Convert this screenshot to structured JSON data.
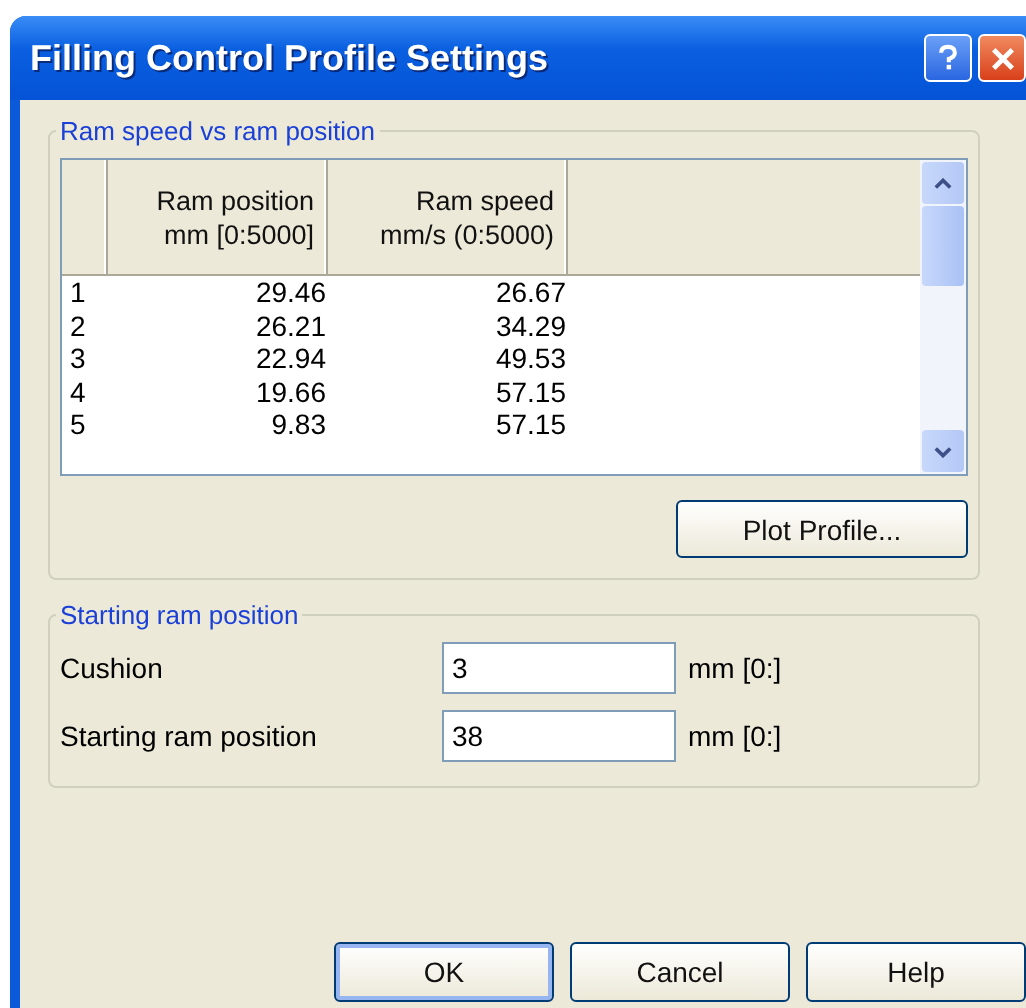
{
  "window": {
    "title": "Filling Control Profile Settings"
  },
  "profile_group": {
    "title": "Ram speed vs ram position",
    "table": {
      "columns": [
        {
          "line1": "Ram position",
          "line2": "mm [0:5000]"
        },
        {
          "line1": "Ram speed",
          "line2": "mm/s (0:5000)"
        }
      ],
      "rows": [
        {
          "index": "1",
          "cells": [
            "29.46",
            "26.67"
          ]
        },
        {
          "index": "2",
          "cells": [
            "26.21",
            "34.29"
          ]
        },
        {
          "index": "3",
          "cells": [
            "22.94",
            "49.53"
          ]
        },
        {
          "index": "4",
          "cells": [
            "19.66",
            "57.15"
          ]
        },
        {
          "index": "5",
          "cells": [
            "9.83",
            "57.15"
          ]
        }
      ]
    },
    "plot_button": "Plot Profile..."
  },
  "start_group": {
    "title": "Starting ram position",
    "fields": [
      {
        "label": "Cushion",
        "value": "3",
        "unit": "mm [0:]"
      },
      {
        "label": "Starting ram position",
        "value": "38",
        "unit": "mm [0:]"
      }
    ]
  },
  "buttons": [
    {
      "label": "OK",
      "default": true
    },
    {
      "label": "Cancel",
      "default": false
    },
    {
      "label": "Help",
      "default": false
    }
  ]
}
